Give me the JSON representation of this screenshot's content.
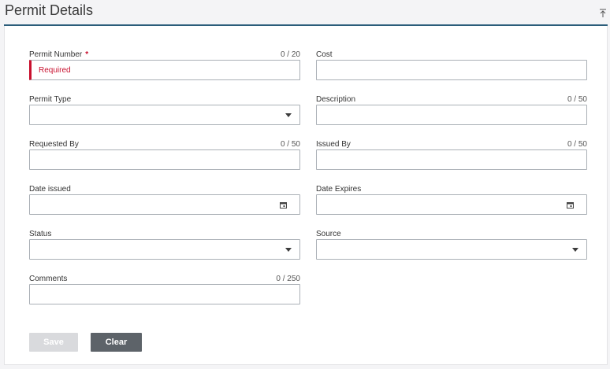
{
  "header": {
    "title": "Permit Details",
    "collapse_icon": "collapse-up-icon"
  },
  "form": {
    "permit_number": {
      "label": "Permit Number",
      "required_marker": "*",
      "counter": "0 / 20",
      "value": "",
      "error": "Required"
    },
    "cost": {
      "label": "Cost",
      "value": ""
    },
    "permit_type": {
      "label": "Permit Type",
      "selected": ""
    },
    "description": {
      "label": "Description",
      "counter": "0 / 50",
      "value": ""
    },
    "requested_by": {
      "label": "Requested By",
      "counter": "0 / 50",
      "value": ""
    },
    "issued_by": {
      "label": "Issued By",
      "counter": "0 / 50",
      "value": ""
    },
    "date_issued": {
      "label": "Date issued",
      "value": ""
    },
    "date_expires": {
      "label": "Date Expires",
      "value": ""
    },
    "status": {
      "label": "Status",
      "selected": ""
    },
    "source": {
      "label": "Source",
      "selected": ""
    },
    "comments": {
      "label": "Comments",
      "counter": "0 / 250",
      "value": ""
    }
  },
  "actions": {
    "save_label": "Save",
    "clear_label": "Clear"
  },
  "colors": {
    "accent_rule": "#2b5d7a",
    "error": "#c8102e",
    "button_disabled": "#d9dadd",
    "button_secondary": "#5d6369"
  }
}
